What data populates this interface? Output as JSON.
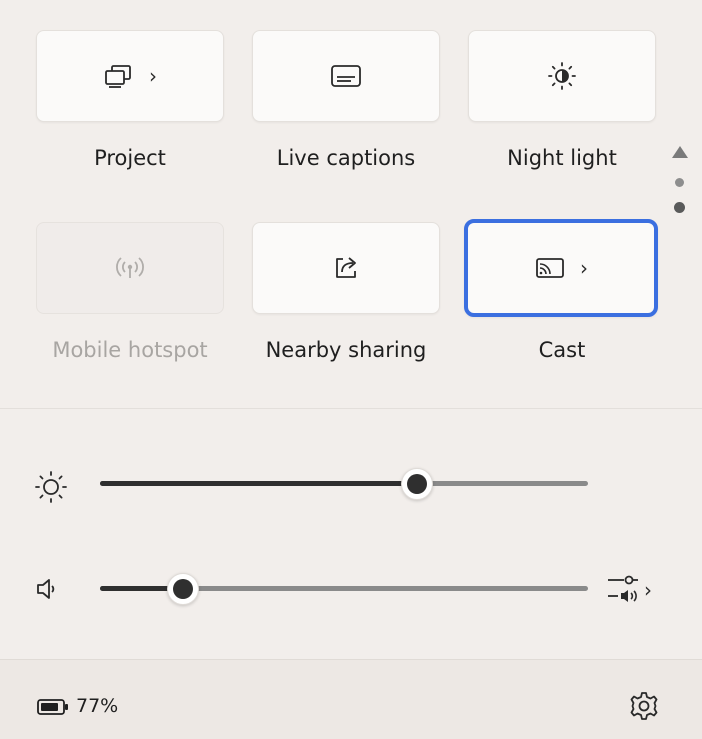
{
  "tiles_row1": [
    {
      "label": "Project",
      "icon": "project-icon",
      "has_chevron": true
    },
    {
      "label": "Live captions",
      "icon": "live-captions-icon",
      "has_chevron": false
    },
    {
      "label": "Night light",
      "icon": "night-light-icon",
      "has_chevron": false
    }
  ],
  "tiles_row2": [
    {
      "label": "Mobile hotspot",
      "icon": "mobile-hotspot-icon",
      "has_chevron": false,
      "disabled": true
    },
    {
      "label": "Nearby sharing",
      "icon": "nearby-sharing-icon",
      "has_chevron": false
    },
    {
      "label": "Cast",
      "icon": "cast-icon",
      "has_chevron": true,
      "focused": true
    }
  ],
  "chevron_glyph": "›",
  "pager": {
    "pages": 3,
    "current": 1
  },
  "brightness": {
    "icon": "brightness-icon",
    "level_percent": 65
  },
  "volume": {
    "icon": "speaker-icon",
    "level_percent": 17,
    "mixer_icon": "audio-mixer-icon"
  },
  "footer": {
    "battery_icon": "battery-icon",
    "battery_text": "77%",
    "settings_icon": "gear-icon"
  },
  "colors": {
    "focus_ring": "#3b6fe0",
    "background": "#f2eeeb",
    "tile": "#fbfaf9"
  }
}
